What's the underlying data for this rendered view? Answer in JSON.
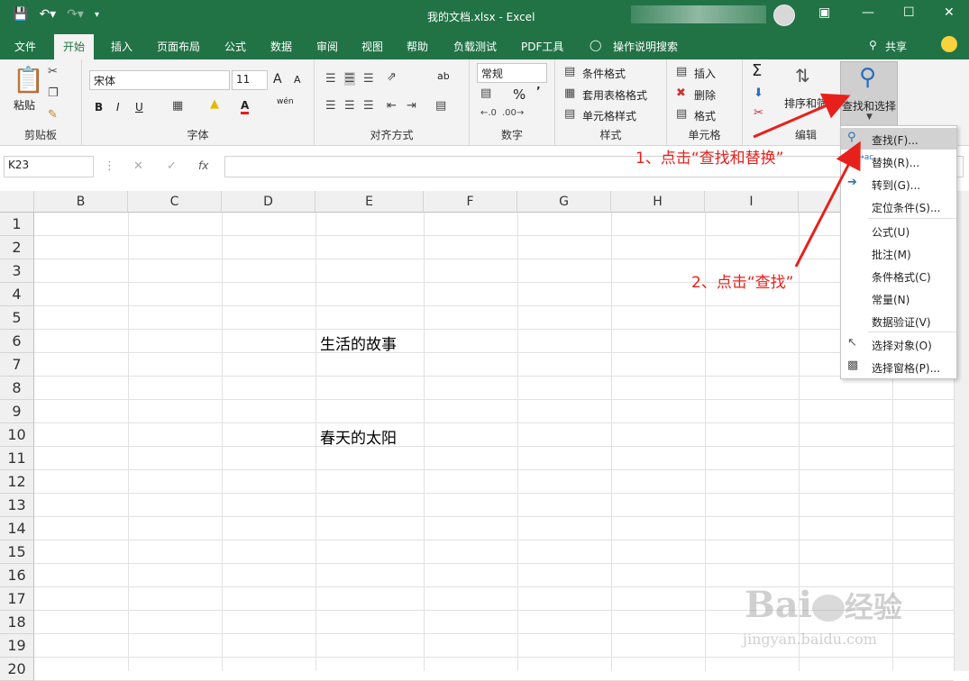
{
  "title": {
    "document": "我的文档.xlsx",
    "sep": "-",
    "app": "Excel"
  },
  "tabs": [
    "文件",
    "开始",
    "插入",
    "页面布局",
    "公式",
    "数据",
    "审阅",
    "视图",
    "帮助",
    "负载测试",
    "PDF工具",
    "操作说明搜索",
    "共享"
  ],
  "clipboard": {
    "paste": "粘贴",
    "label": "剪贴板"
  },
  "font": {
    "name": "宋体",
    "size": "11",
    "label": "字体",
    "grow": "A",
    "shrink": "A",
    "bold": "B",
    "italic": "I",
    "underline": "U",
    "color": "A",
    "wen": "wén"
  },
  "alignment": {
    "label": "对齐方式",
    "wrap": "ab"
  },
  "number": {
    "format": "常规",
    "label": "数字",
    "percent": "%",
    "comma": "’"
  },
  "styles": {
    "cond": "条件格式",
    "table": "套用表格格式",
    "cell": "单元格样式",
    "label": "样式"
  },
  "cells": {
    "insert": "插入",
    "delete": "删除",
    "format": "格式",
    "label": "单元格"
  },
  "editing": {
    "sort": "排序和筛选",
    "find": "查找和选择",
    "label": "编辑",
    "sigma": "Σ"
  },
  "formula_bar": {
    "name_box": "K23",
    "fx": "fx"
  },
  "sheet": {
    "columns": [
      "B",
      "C",
      "D",
      "E",
      "F",
      "G",
      "H",
      "I"
    ],
    "rows": [
      "1",
      "2",
      "3",
      "4",
      "5",
      "6",
      "7",
      "8",
      "9",
      "10",
      "11",
      "12",
      "13",
      "14",
      "15",
      "16",
      "17",
      "18",
      "19",
      "20"
    ],
    "e6": "生活的故事",
    "e10": "春天的太阳"
  },
  "menu": [
    "查找(F)...",
    "替换(R)...",
    "转到(G)...",
    "定位条件(S)...",
    "公式(U)",
    "批注(M)",
    "条件格式(C)",
    "常量(N)",
    "数据验证(V)",
    "选择对象(O)",
    "选择窗格(P)..."
  ],
  "annotations": {
    "step1": "1、点击“查找和替换”",
    "step2": "2、点击“查找”"
  },
  "watermark": {
    "brand": "Bai",
    "brand2": "经验",
    "url": "jingyan.baidu.com"
  },
  "colors": {
    "excel_green": "#217346",
    "annotation_red": "#e8201b"
  }
}
